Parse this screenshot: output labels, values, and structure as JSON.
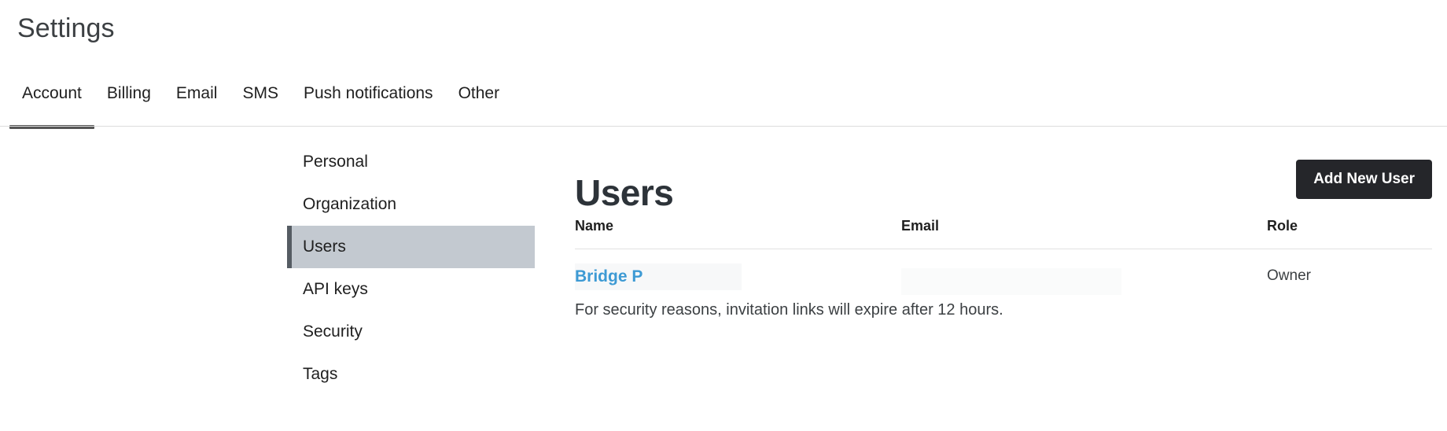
{
  "header": {
    "title": "Settings"
  },
  "tabs": {
    "active_index": 0,
    "items": [
      {
        "label": "Account"
      },
      {
        "label": "Billing"
      },
      {
        "label": "Email"
      },
      {
        "label": "SMS"
      },
      {
        "label": "Push notifications"
      },
      {
        "label": "Other"
      }
    ]
  },
  "sidebar": {
    "active_index": 2,
    "items": [
      {
        "label": "Personal"
      },
      {
        "label": "Organization"
      },
      {
        "label": "Users"
      },
      {
        "label": "API keys"
      },
      {
        "label": "Security"
      },
      {
        "label": "Tags"
      }
    ]
  },
  "main": {
    "title": "Users",
    "add_user_label": "Add New User",
    "table": {
      "columns": [
        "Name",
        "Email",
        "Role"
      ],
      "rows": [
        {
          "name": "Bridge P",
          "email": "",
          "role": "Owner"
        }
      ]
    },
    "note": "For security reasons, invitation links will expire after 12 hours."
  },
  "colors": {
    "accent_link": "#3d9ad4",
    "active_tab_underline": "#555555",
    "sidebar_active_bg": "#c3c9d0",
    "sidebar_active_border": "#555c63",
    "button_bg": "#25262a",
    "heading": "#2d3339",
    "divider": "#dcdcdc",
    "redaction": "#f7f8f9"
  }
}
